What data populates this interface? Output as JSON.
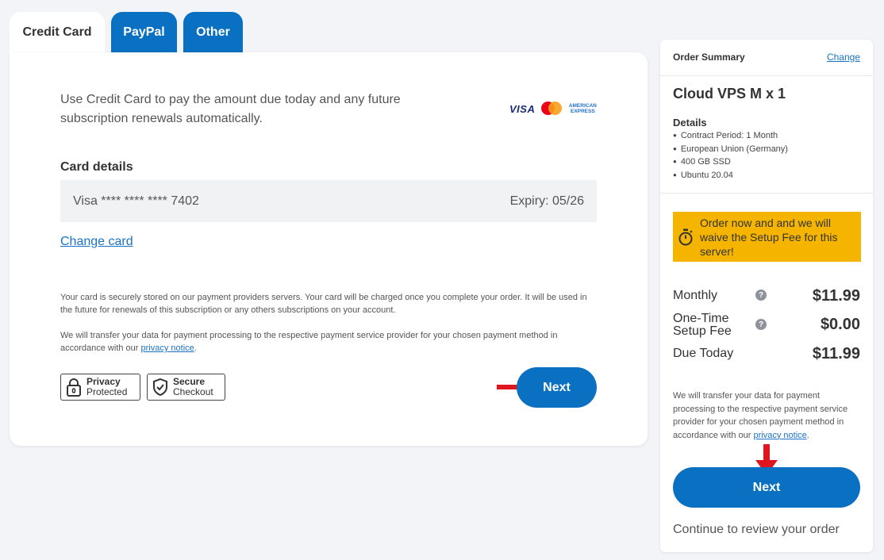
{
  "tabs": [
    {
      "label": "Credit Card",
      "active": true
    },
    {
      "label": "PayPal",
      "active": false
    },
    {
      "label": "Other",
      "active": false
    }
  ],
  "payment": {
    "intro": "Use Credit Card to pay the amount due today and any future subscription renewals automatically.",
    "logos": {
      "visa": "VISA",
      "amex": "AMERICAN EXPRESS"
    },
    "card_details_title": "Card details",
    "card_number": "Visa **** **** **** 7402",
    "expiry": "Expiry: 05/26",
    "change_card": "Change card",
    "note1": "Your card is securely stored on our payment providers servers. Your card will be charged once you complete your order. It will be used in the future for renewals of this subscription or any others subscriptions on your account.",
    "note2_prefix": "We will transfer your data for payment processing to the respective payment service provider for your chosen payment method in accordance with our ",
    "note2_link": "privacy notice",
    "note2_suffix": ".",
    "badge_privacy": {
      "title": "Privacy",
      "sub": "Protected"
    },
    "badge_secure": {
      "title": "Secure",
      "sub": "Checkout"
    },
    "next_label": "Next"
  },
  "summary": {
    "title": "Order Summary",
    "change": "Change",
    "product": "Cloud VPS M x 1",
    "details_label": "Details",
    "details": [
      "Contract Period: 1 Month",
      "European Union (Germany)",
      "400 GB SSD",
      "Ubuntu 20.04"
    ],
    "promo": "Order now and and we will waive the Setup Fee for this server!",
    "monthly_label": "Monthly",
    "monthly_value": "$11.99",
    "setup_label_1": "One-Time",
    "setup_label_2": "Setup Fee",
    "setup_value": "$0.00",
    "due_label": "Due Today",
    "due_value": "$11.99",
    "help_glyph": "?",
    "note_prefix": "We will transfer your data for payment processing to the respective payment service provider for your chosen payment method in accordance with our ",
    "note_link": "privacy notice",
    "note_suffix": ".",
    "next_label": "Next",
    "continue": "Continue to review your order"
  },
  "colors": {
    "primary": "#0a70c2",
    "promo": "#f5b400",
    "arrow": "#e0161f",
    "link": "#1a73c6"
  }
}
